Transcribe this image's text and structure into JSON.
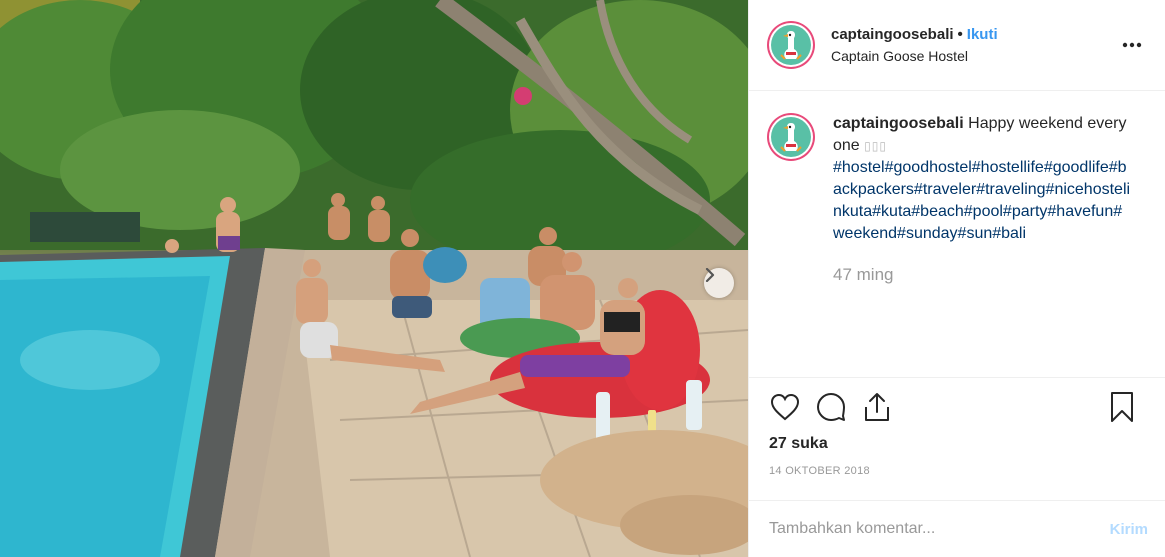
{
  "post": {
    "username": "captaingoosebali",
    "separator": "•",
    "follow_label": "Ikuti",
    "location": "Captain Goose Hostel"
  },
  "caption": {
    "username": "captaingoosebali",
    "text": "Happy weekend everyone",
    "emoji": "▯▯▯",
    "hashtags": "#hostel#goodhostel#hostellife#goodlife#backpackers#traveler#traveling#nicehostelinkuta#kuta#beach#pool#party#havefun#weekend#sunday#sun#bali",
    "age": "47 ming"
  },
  "stats": {
    "likes": "27 suka",
    "date": "14 OKTOBER 2018"
  },
  "comment": {
    "placeholder": "Tambahkan komentar...",
    "post_label": "Kirim"
  },
  "icons": {
    "like": "heart-icon",
    "comment": "comment-icon",
    "share": "share-icon",
    "save": "bookmark-icon",
    "more": "more-options-icon",
    "next": "chevron-right-icon"
  },
  "colors": {
    "link_blue": "#3897f0",
    "hashtag": "#003569",
    "muted": "#999999",
    "post_disabled": "#b3dbff",
    "avatar_ring": "#e84a7a",
    "logo_bg": "#59c0a6"
  }
}
